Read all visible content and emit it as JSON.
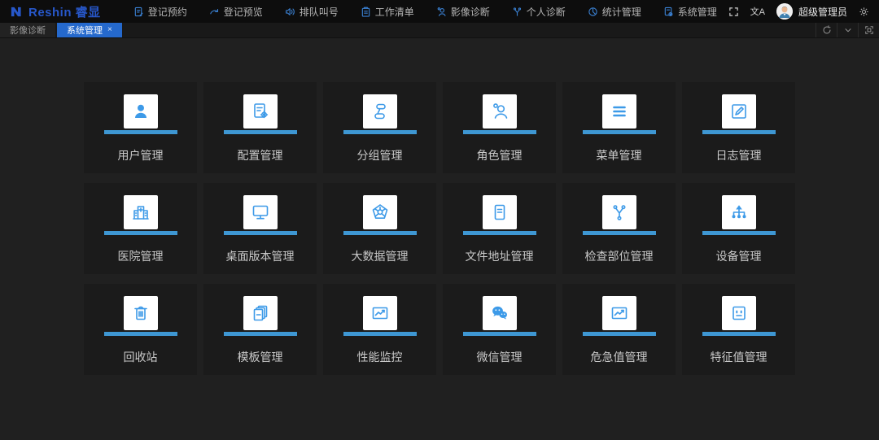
{
  "brand": {
    "name": "Reshin 睿显"
  },
  "topnav": {
    "items": [
      {
        "label": "登记预约",
        "icon": "register-appointment-icon"
      },
      {
        "label": "登记预览",
        "icon": "register-preview-icon"
      },
      {
        "label": "排队叫号",
        "icon": "queue-call-icon"
      },
      {
        "label": "工作清单",
        "icon": "worklist-icon"
      },
      {
        "label": "影像诊断",
        "icon": "imaging-diagnosis-icon"
      },
      {
        "label": "个人诊断",
        "icon": "personal-diagnosis-icon"
      },
      {
        "label": "统计管理",
        "icon": "statistics-icon"
      },
      {
        "label": "系统管理",
        "icon": "system-manage-icon"
      }
    ]
  },
  "topbar_right": {
    "translate_glyph": "文A",
    "username": "超级管理员",
    "icons": [
      "fullscreen-icon",
      "translate-icon",
      "avatar",
      "gear-icon"
    ]
  },
  "tabbar": {
    "tabs": [
      {
        "label": "影像诊断",
        "active": false
      },
      {
        "label": "系统管理",
        "active": true,
        "close_glyph": "×"
      }
    ],
    "actions": [
      "refresh-icon",
      "chevron-down-icon",
      "frame-icon"
    ]
  },
  "grid": {
    "items": [
      {
        "label": "用户管理",
        "icon": "user-icon"
      },
      {
        "label": "配置管理",
        "icon": "config-icon"
      },
      {
        "label": "分组管理",
        "icon": "group-icon"
      },
      {
        "label": "角色管理",
        "icon": "role-icon"
      },
      {
        "label": "菜单管理",
        "icon": "menu-icon"
      },
      {
        "label": "日志管理",
        "icon": "log-icon"
      },
      {
        "label": "医院管理",
        "icon": "hospital-icon"
      },
      {
        "label": "桌面版本管理",
        "icon": "desktop-version-icon"
      },
      {
        "label": "大数据管理",
        "icon": "bigdata-icon"
      },
      {
        "label": "文件地址管理",
        "icon": "file-address-icon"
      },
      {
        "label": "检查部位管理",
        "icon": "exam-bodypart-icon"
      },
      {
        "label": "设备管理",
        "icon": "device-icon"
      },
      {
        "label": "回收站",
        "icon": "recycle-bin-icon"
      },
      {
        "label": "模板管理",
        "icon": "template-icon"
      },
      {
        "label": "性能监控",
        "icon": "performance-monitor-icon"
      },
      {
        "label": "微信管理",
        "icon": "wechat-icon"
      },
      {
        "label": "危急值管理",
        "icon": "critical-value-icon"
      },
      {
        "label": "特征值管理",
        "icon": "feature-value-icon"
      }
    ]
  },
  "colors": {
    "accent_blue": "#3d9ae8",
    "underline_blue": "#3e97d3",
    "tab_active_blue": "#2569cd",
    "logo_blue": "#2757c9",
    "topbar_bg": "#0d0d0d",
    "page_bg": "#202020",
    "card_bg": "#1b1b1b"
  }
}
